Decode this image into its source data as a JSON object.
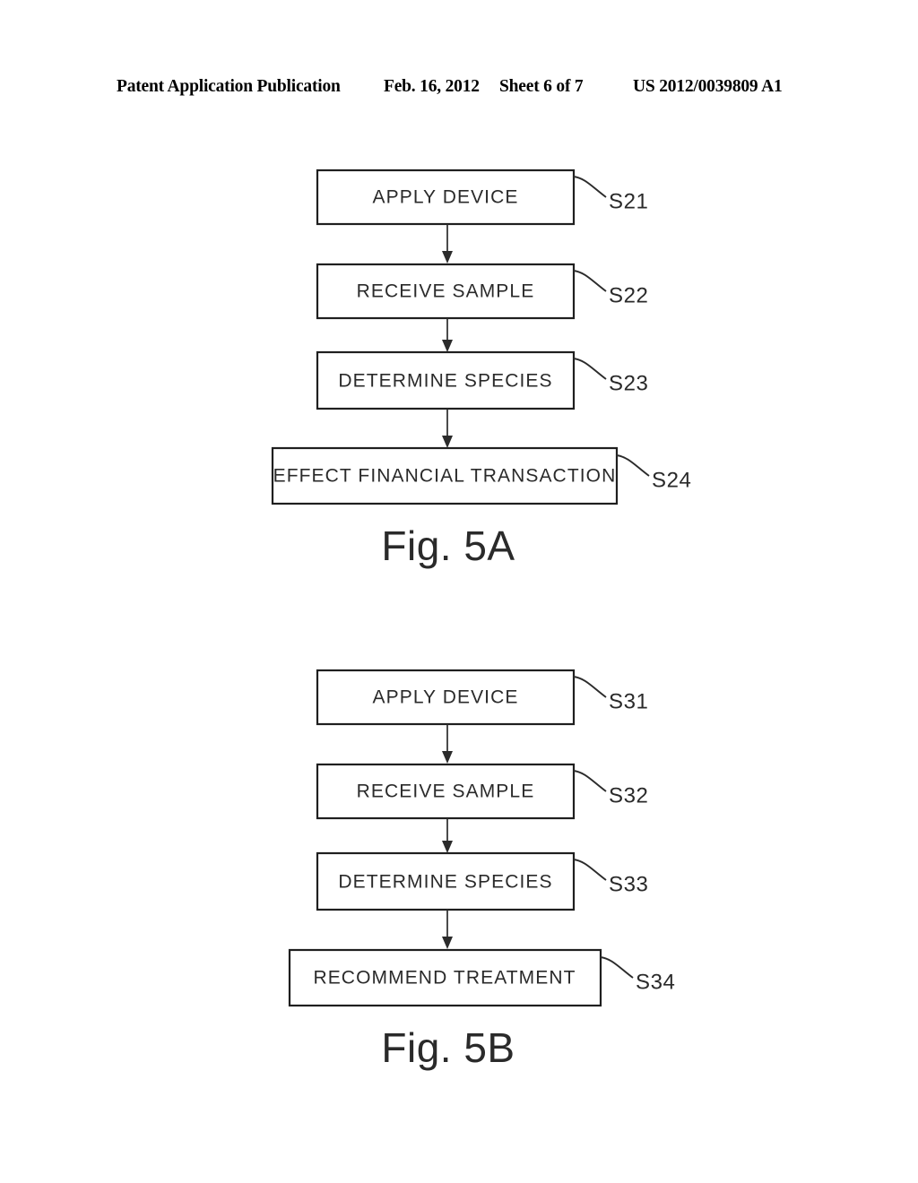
{
  "header": {
    "publication": "Patent Application Publication",
    "date": "Feb. 16, 2012",
    "sheet": "Sheet 6 of 7",
    "patent_number": "US 2012/0039809 A1"
  },
  "figures": [
    {
      "id": "5A",
      "caption": "Fig. 5A",
      "steps": [
        {
          "label": "APPLY DEVICE",
          "ref": "S21"
        },
        {
          "label": "RECEIVE SAMPLE",
          "ref": "S22"
        },
        {
          "label": "DETERMINE SPECIES",
          "ref": "S23"
        },
        {
          "label": "EFFECT FINANCIAL TRANSACTION",
          "ref": "S24"
        }
      ]
    },
    {
      "id": "5B",
      "caption": "Fig. 5B",
      "steps": [
        {
          "label": "APPLY DEVICE",
          "ref": "S31"
        },
        {
          "label": "RECEIVE SAMPLE",
          "ref": "S32"
        },
        {
          "label": "DETERMINE SPECIES",
          "ref": "S33"
        },
        {
          "label": "RECOMMEND TREATMENT",
          "ref": "S34"
        }
      ]
    }
  ],
  "colors": {
    "ink": "#2a2a2a",
    "line": "#1f1f1f",
    "paper": "#ffffff"
  }
}
